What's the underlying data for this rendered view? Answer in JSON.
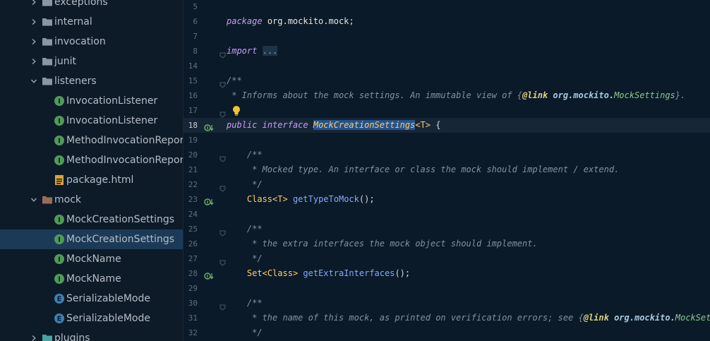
{
  "tree": {
    "items": [
      {
        "label": "exceptions",
        "type": "folder",
        "arrow": "right",
        "indent": 0
      },
      {
        "label": "internal",
        "type": "folder",
        "arrow": "right",
        "indent": 0
      },
      {
        "label": "invocation",
        "type": "folder",
        "arrow": "right",
        "indent": 0
      },
      {
        "label": "junit",
        "type": "folder",
        "arrow": "right",
        "indent": 0
      },
      {
        "label": "listeners",
        "type": "folder",
        "arrow": "down",
        "indent": 0
      },
      {
        "label": "InvocationListener",
        "type": "interface",
        "indent": 1
      },
      {
        "label": "InvocationListener",
        "type": "interface",
        "indent": 1
      },
      {
        "label": "MethodInvocationReport",
        "type": "interface",
        "indent": 1
      },
      {
        "label": "MethodInvocationReport",
        "type": "interface",
        "indent": 1
      },
      {
        "label": "package.html",
        "type": "html",
        "indent": 1
      },
      {
        "label": "mock",
        "type": "folder-brown",
        "arrow": "down",
        "indent": 0
      },
      {
        "label": "MockCreationSettings",
        "type": "interface",
        "indent": 1
      },
      {
        "label": "MockCreationSettings",
        "type": "interface",
        "indent": 1,
        "selected": true
      },
      {
        "label": "MockName",
        "type": "interface",
        "indent": 1
      },
      {
        "label": "MockName",
        "type": "interface",
        "indent": 1
      },
      {
        "label": "SerializableMode",
        "type": "enum",
        "indent": 1
      },
      {
        "label": "SerializableMode",
        "type": "enum",
        "indent": 1
      },
      {
        "label": "plugins",
        "type": "folder-teal",
        "arrow": "right",
        "indent": 0
      }
    ]
  },
  "editor": {
    "lines": [
      {
        "num": "5",
        "tokens": []
      },
      {
        "num": "6",
        "tokens": [
          {
            "t": "package",
            "c": "kw"
          },
          {
            "t": " ",
            "c": "plain"
          },
          {
            "t": "org.mockito.mock",
            "c": "pkg"
          },
          {
            "t": ";",
            "c": "plain"
          }
        ]
      },
      {
        "num": "7",
        "tokens": []
      },
      {
        "num": "8",
        "tokens": [
          {
            "t": "import",
            "c": "kw"
          },
          {
            "t": " ",
            "c": "plain"
          },
          {
            "t": "...",
            "c": "fold-box"
          }
        ],
        "fold": true
      },
      {
        "num": "14",
        "tokens": []
      },
      {
        "num": "15",
        "tokens": [
          {
            "t": "/**",
            "c": "cmt"
          }
        ],
        "fold": true
      },
      {
        "num": "16",
        "tokens": [
          {
            "t": " * Informs about the mock settings. An immutable view of {",
            "c": "cmt"
          },
          {
            "t": "@link",
            "c": "tag"
          },
          {
            "t": " org.mockito.",
            "c": "tagref"
          },
          {
            "t": "MockSettings",
            "c": "tagcls"
          },
          {
            "t": "}.",
            "c": "cmt"
          }
        ]
      },
      {
        "num": "17",
        "tokens": [],
        "bulb": true,
        "fold": true
      },
      {
        "num": "18",
        "tokens": [
          {
            "t": "public",
            "c": "kw"
          },
          {
            "t": " ",
            "c": "plain"
          },
          {
            "t": "interface",
            "c": "kw"
          },
          {
            "t": " ",
            "c": "plain"
          },
          {
            "t": "MockCreationSettings",
            "c": "sel"
          },
          {
            "t": "<T>",
            "c": "cls"
          },
          {
            "t": " {",
            "c": "plain"
          }
        ],
        "current": true,
        "impl": true
      },
      {
        "num": "19",
        "tokens": []
      },
      {
        "num": "20",
        "tokens": [
          {
            "t": "    /**",
            "c": "cmt"
          }
        ],
        "fold": true
      },
      {
        "num": "21",
        "tokens": [
          {
            "t": "     * Mocked type. An interface or class the mock should implement / extend.",
            "c": "cmt"
          }
        ]
      },
      {
        "num": "22",
        "tokens": [
          {
            "t": "     */",
            "c": "cmt"
          }
        ],
        "fold": true
      },
      {
        "num": "23",
        "tokens": [
          {
            "t": "    ",
            "c": "plain"
          },
          {
            "t": "Class",
            "c": "cls"
          },
          {
            "t": "<T>",
            "c": "cls"
          },
          {
            "t": " ",
            "c": "plain"
          },
          {
            "t": "getTypeToMock",
            "c": "meth"
          },
          {
            "t": "();",
            "c": "plain"
          }
        ],
        "impl": true
      },
      {
        "num": "24",
        "tokens": []
      },
      {
        "num": "25",
        "tokens": [
          {
            "t": "    /**",
            "c": "cmt"
          }
        ],
        "fold": true
      },
      {
        "num": "26",
        "tokens": [
          {
            "t": "     * the extra interfaces the mock object should implement.",
            "c": "cmt"
          }
        ]
      },
      {
        "num": "27",
        "tokens": [
          {
            "t": "     */",
            "c": "cmt"
          }
        ],
        "fold": true
      },
      {
        "num": "28",
        "tokens": [
          {
            "t": "    ",
            "c": "plain"
          },
          {
            "t": "Set",
            "c": "cls"
          },
          {
            "t": "<Class>",
            "c": "cls"
          },
          {
            "t": " ",
            "c": "plain"
          },
          {
            "t": "getExtraInterfaces",
            "c": "meth"
          },
          {
            "t": "();",
            "c": "plain"
          }
        ],
        "impl": true
      },
      {
        "num": "29",
        "tokens": []
      },
      {
        "num": "30",
        "tokens": [
          {
            "t": "    /**",
            "c": "cmt"
          }
        ],
        "fold": true
      },
      {
        "num": "31",
        "tokens": [
          {
            "t": "     * the name of this mock, as printed on verification errors; see {",
            "c": "cmt"
          },
          {
            "t": "@link",
            "c": "tag"
          },
          {
            "t": " org.mockito.",
            "c": "tagref"
          },
          {
            "t": "MockSetting",
            "c": "tagcls"
          }
        ]
      },
      {
        "num": "32",
        "tokens": [
          {
            "t": "     */",
            "c": "cmt"
          }
        ]
      }
    ]
  },
  "colors": {
    "folder": "#8a96a3",
    "interface": "#4f9b58",
    "enum": "#3d7fb6",
    "html": "#d9a33a"
  }
}
